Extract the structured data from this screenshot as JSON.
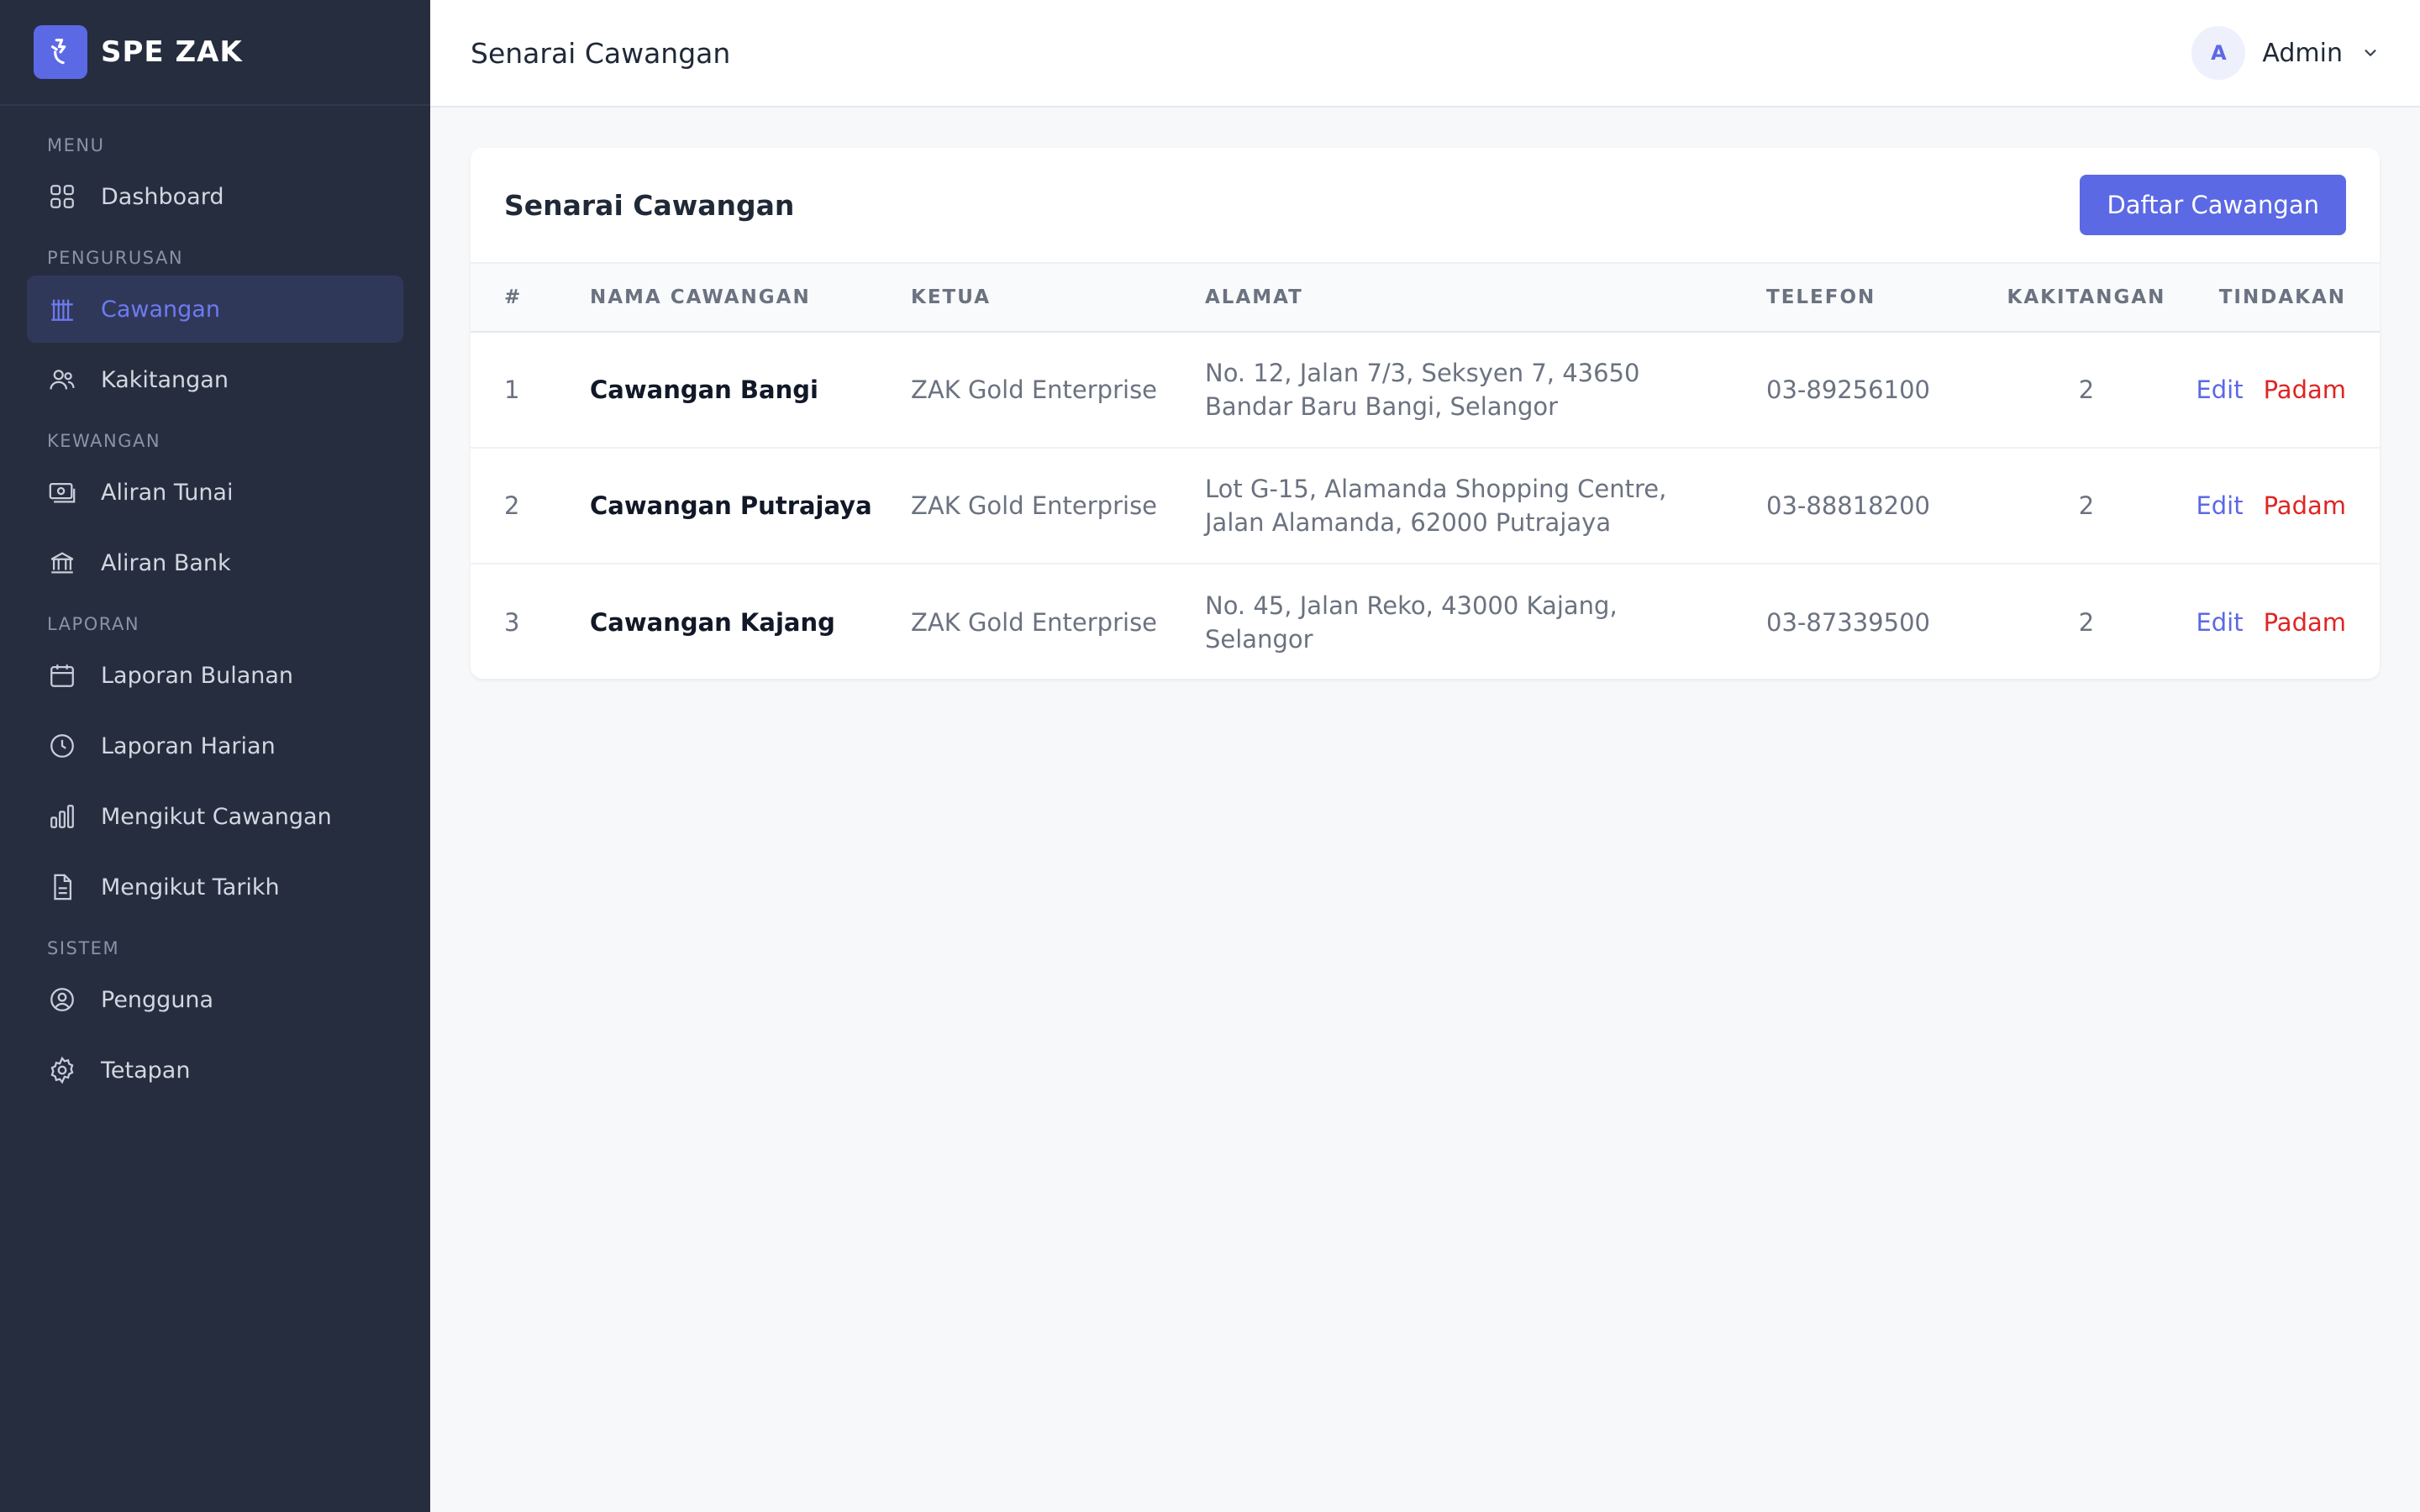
{
  "brand": {
    "name": "SPE ZAK"
  },
  "sidebar": {
    "sections": [
      {
        "title": "MENU",
        "items": [
          {
            "label": "Dashboard",
            "icon": "dashboard-icon"
          }
        ]
      },
      {
        "title": "PENGURUSAN",
        "items": [
          {
            "label": "Cawangan",
            "icon": "building-icon",
            "active": true
          },
          {
            "label": "Kakitangan",
            "icon": "users-icon"
          }
        ]
      },
      {
        "title": "KEWANGAN",
        "items": [
          {
            "label": "Aliran Tunai",
            "icon": "cash-icon"
          },
          {
            "label": "Aliran Bank",
            "icon": "bank-icon"
          }
        ]
      },
      {
        "title": "LAPORAN",
        "items": [
          {
            "label": "Laporan Bulanan",
            "icon": "calendar-icon"
          },
          {
            "label": "Laporan Harian",
            "icon": "clock-icon"
          },
          {
            "label": "Mengikut Cawangan",
            "icon": "bar-chart-icon"
          },
          {
            "label": "Mengikut Tarikh",
            "icon": "document-icon"
          }
        ]
      },
      {
        "title": "SISTEM",
        "items": [
          {
            "label": "Pengguna",
            "icon": "user-circle-icon"
          },
          {
            "label": "Tetapan",
            "icon": "gear-icon"
          }
        ]
      }
    ]
  },
  "header": {
    "title": "Senarai Cawangan",
    "user": {
      "initial": "A",
      "name": "Admin"
    }
  },
  "card": {
    "title": "Senarai Cawangan",
    "add_button": "Daftar Cawangan"
  },
  "table": {
    "columns": [
      "#",
      "NAMA CAWANGAN",
      "KETUA",
      "ALAMAT",
      "TELEFON",
      "KAKITANGAN",
      "TINDAKAN"
    ],
    "rows": [
      {
        "no": "1",
        "name": "Cawangan Bangi",
        "head": "ZAK Gold Enterprise",
        "address": "No. 12, Jalan 7/3, Seksyen 7, 43650 Bandar Baru Bangi, Selangor",
        "phone": "03-89256100",
        "staff": "2",
        "edit": "Edit",
        "delete": "Padam"
      },
      {
        "no": "2",
        "name": "Cawangan Putrajaya",
        "head": "ZAK Gold Enterprise",
        "address": "Lot G-15, Alamanda Shopping Centre, Jalan Alamanda, 62000 Putrajaya",
        "phone": "03-88818200",
        "staff": "2",
        "edit": "Edit",
        "delete": "Padam"
      },
      {
        "no": "3",
        "name": "Cawangan Kajang",
        "head": "ZAK Gold Enterprise",
        "address": "No. 45, Jalan Reko, 43000 Kajang, Selangor",
        "phone": "03-87339500",
        "staff": "2",
        "edit": "Edit",
        "delete": "Padam"
      }
    ]
  },
  "colors": {
    "accent": "#5b69e5",
    "danger": "#e02424",
    "sidebar_bg": "#262d3f"
  }
}
